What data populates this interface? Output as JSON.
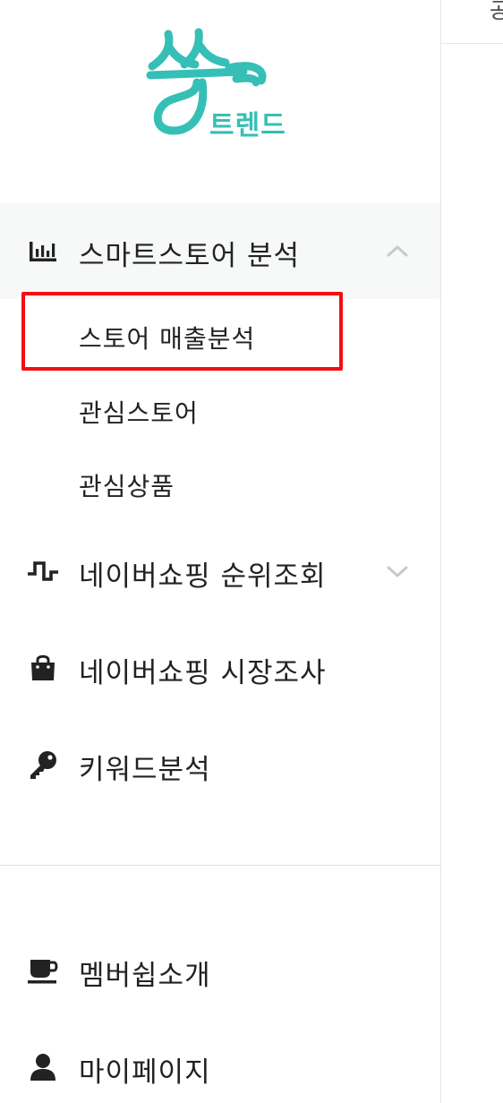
{
  "brand": {
    "logo_text": "트렌드",
    "accent_color": "#35bfb6"
  },
  "right_header": {
    "text": "공"
  },
  "menu": {
    "smartstore": {
      "label": "스마트스토어 분석",
      "icon": "bar-chart-icon",
      "expanded": true,
      "sub_items": [
        {
          "label": "스토어 매출분석",
          "highlighted": true
        },
        {
          "label": "관심스토어"
        },
        {
          "label": "관심상품"
        }
      ]
    },
    "naver_rank": {
      "label": "네이버쇼핑 순위조회",
      "icon": "pulse-wave-icon",
      "expanded": false
    },
    "naver_market": {
      "label": "네이버쇼핑 시장조사",
      "icon": "shopping-bag-icon"
    },
    "keyword": {
      "label": "키워드분석",
      "icon": "key-icon"
    },
    "membership": {
      "label": "멤버쉽소개",
      "icon": "coffee-cup-icon"
    },
    "mypage": {
      "label": "마이페이지",
      "icon": "user-icon"
    }
  },
  "colors": {
    "highlight_border": "#f50d12",
    "active_section_bg": "#f7f8f8"
  }
}
